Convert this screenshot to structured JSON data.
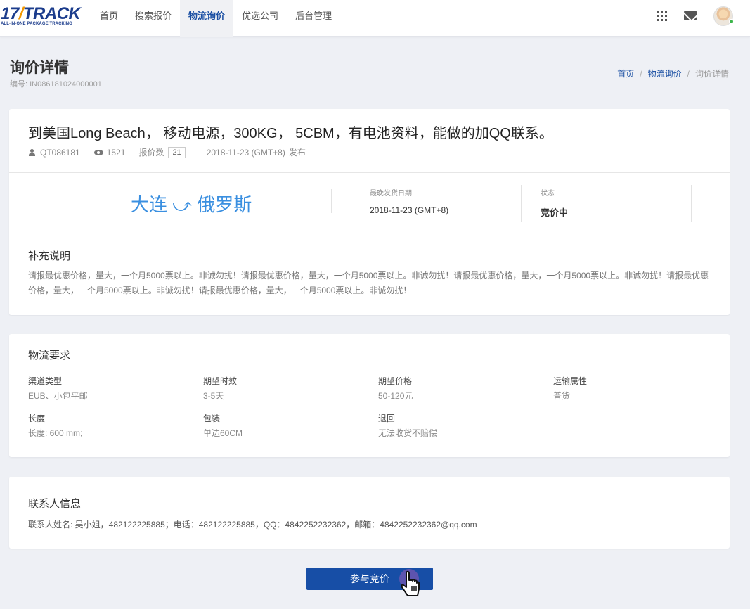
{
  "logo": {
    "main_prefix": "17",
    "main_accent": "/",
    "main_suffix": "TRACK",
    "tagline": "ALL-IN-ONE PACKAGE TRACKING"
  },
  "nav": {
    "items": [
      {
        "label": "首页"
      },
      {
        "label": "搜索报价"
      },
      {
        "label": "物流询价"
      },
      {
        "label": "优选公司"
      },
      {
        "label": "后台管理"
      }
    ],
    "active_index": 2
  },
  "header_icons": {
    "apps": "apps-grid-icon",
    "mail": "mail-icon",
    "avatar": "avatar",
    "status_color": "#3cb54a"
  },
  "page": {
    "title": "询价详情",
    "id_label": "编号: IN086181024000001"
  },
  "breadcrumb": {
    "home": "首页",
    "section": "物流询价",
    "current": "询价详情",
    "separator": "/"
  },
  "inquiry": {
    "headline": "到美国Long Beach， 移动电源，300KG， 5CBM，有电池资料，能做的加QQ联系。",
    "user": "QT086181",
    "views": "1521",
    "quote_label": "报价数",
    "quote_count": "21",
    "published_date": "2018-11-23 (GMT+8)",
    "published_suffix": "发布",
    "route": "大连 ⤻ 俄罗斯",
    "latest_ship_label": "最晚发货日期",
    "latest_ship_value": "2018-11-23 (GMT+8)",
    "status_label": "状态",
    "status_value": "竞价中",
    "notes_title": "补充说明",
    "notes_text": "请报最优惠价格，量大，一个月5000票以上。非诚勿扰！请报最优惠价格，量大，一个月5000票以上。非诚勿扰！请报最优惠价格，量大，一个月5000票以上。非诚勿扰！请报最优惠价格，量大，一个月5000票以上。非诚勿扰！请报最优惠价格，量大，一个月5000票以上。非诚勿扰！"
  },
  "requirements": {
    "title": "物流要求",
    "fields": [
      {
        "label": "渠道类型",
        "value": "EUB、小包平邮"
      },
      {
        "label": "期望时效",
        "value": "3-5天"
      },
      {
        "label": "期望价格",
        "value": "50-120元"
      },
      {
        "label": "运输属性",
        "value": "普货"
      },
      {
        "label": "长度",
        "value": "长度: 600 mm;"
      },
      {
        "label": "包装",
        "value": "单边60CM"
      },
      {
        "label": "退回",
        "value": "无法收货不赔偿"
      }
    ]
  },
  "contact": {
    "title": "联系人信息",
    "line": "联系人姓名: 吴小姐，482122225885；电话：482122225885，QQ：4842252232362，邮箱：4842252232362@qq.com"
  },
  "actions": {
    "bid_label": "参与竞价",
    "primary_color": "#174ea6"
  }
}
